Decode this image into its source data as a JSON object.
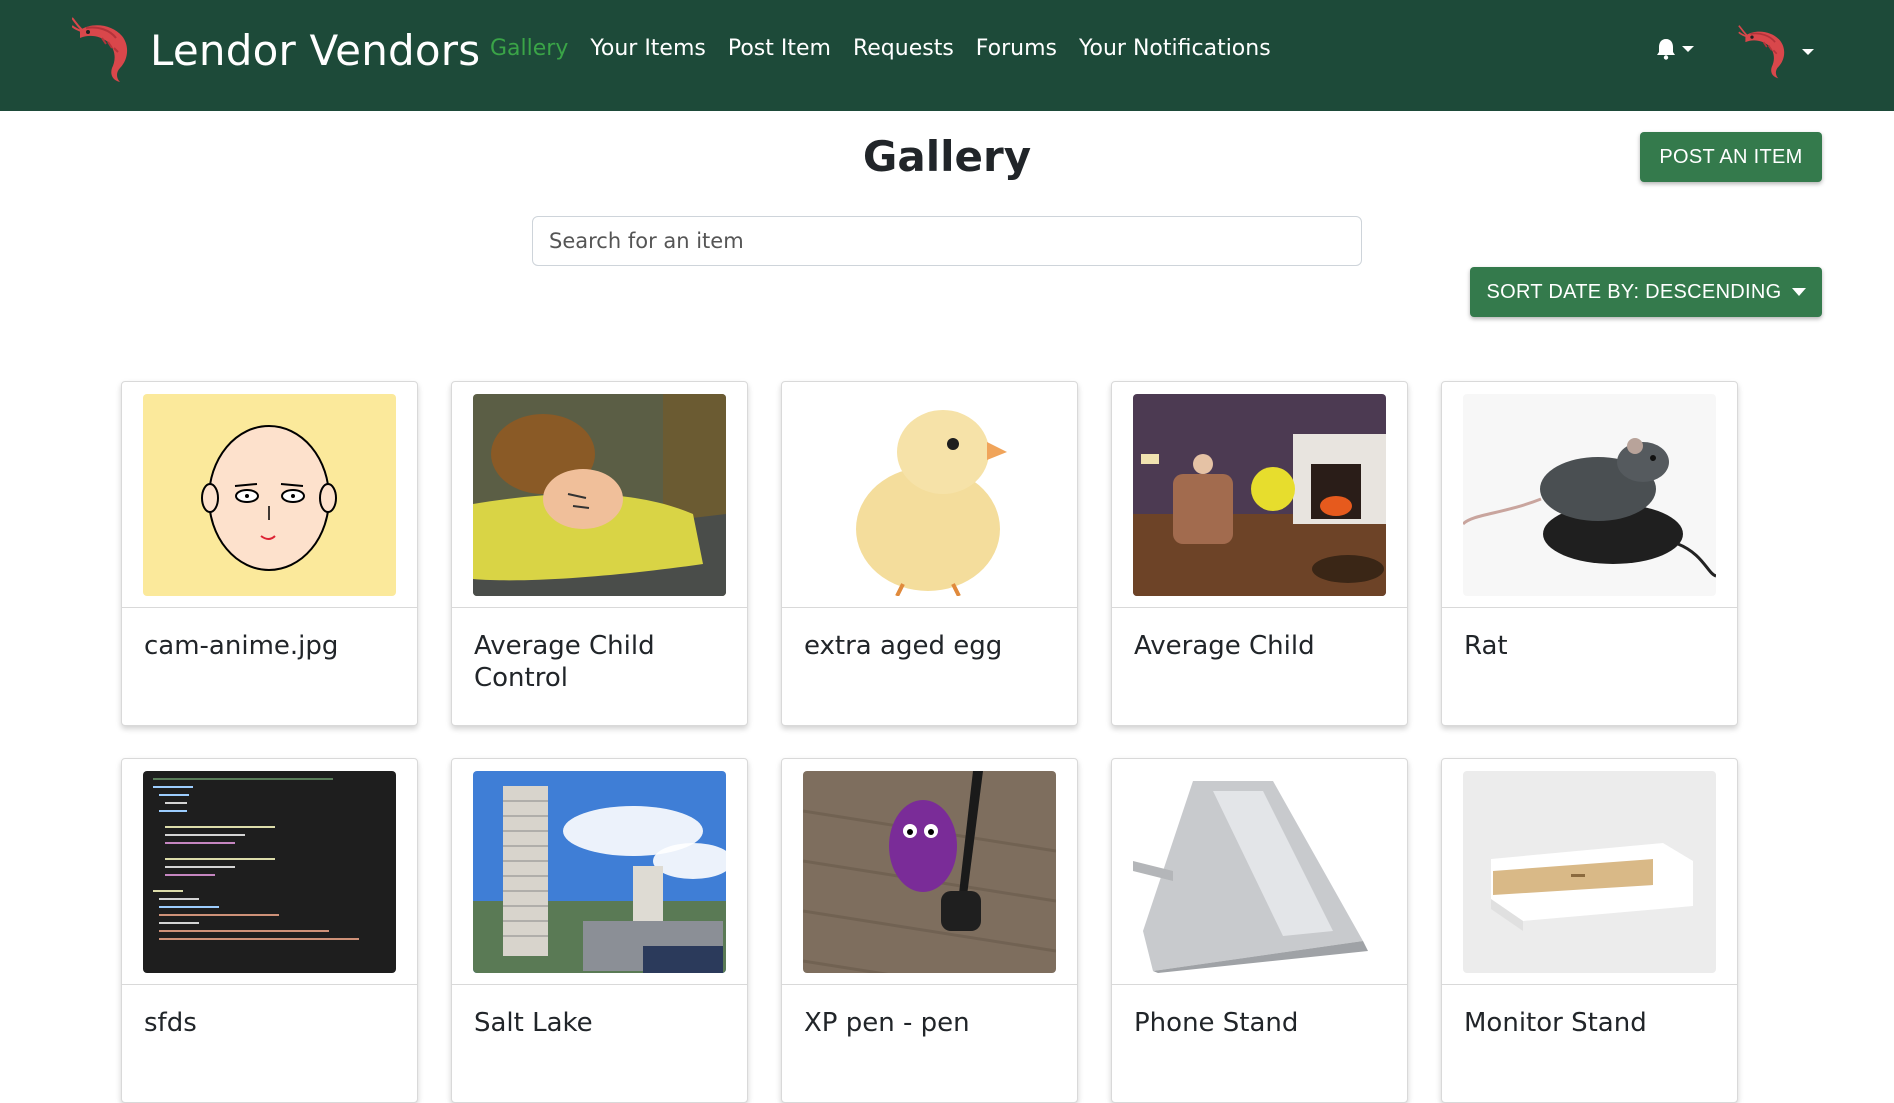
{
  "brand": {
    "name": "Lendor Vendors",
    "logo_icon": "shrimp-icon",
    "logo_color": "#d9474b"
  },
  "nav": {
    "items": [
      {
        "label": "Gallery",
        "active": true
      },
      {
        "label": "Your Items"
      },
      {
        "label": "Post Item"
      },
      {
        "label": "Requests"
      },
      {
        "label": "Forums"
      },
      {
        "label": "Your Notifications"
      }
    ],
    "notifications_icon": "bell-icon",
    "user_icon": "shrimp-icon"
  },
  "page": {
    "title": "Gallery",
    "post_button_label": "POST AN ITEM",
    "search_placeholder": "Search for an item",
    "sort_button_label": "SORT DATE BY: DESCENDING"
  },
  "colors": {
    "navbar": "#1d4a39",
    "active_link": "#3aa447",
    "button": "#347a4c"
  },
  "items": [
    {
      "title": "cam-anime.jpg"
    },
    {
      "title": "Average Child Control"
    },
    {
      "title": "extra aged egg"
    },
    {
      "title": "Average Child"
    },
    {
      "title": "Rat"
    },
    {
      "title": "sfds"
    },
    {
      "title": "Salt Lake"
    },
    {
      "title": "XP pen - pen"
    },
    {
      "title": "Phone Stand"
    },
    {
      "title": "Monitor Stand"
    }
  ]
}
